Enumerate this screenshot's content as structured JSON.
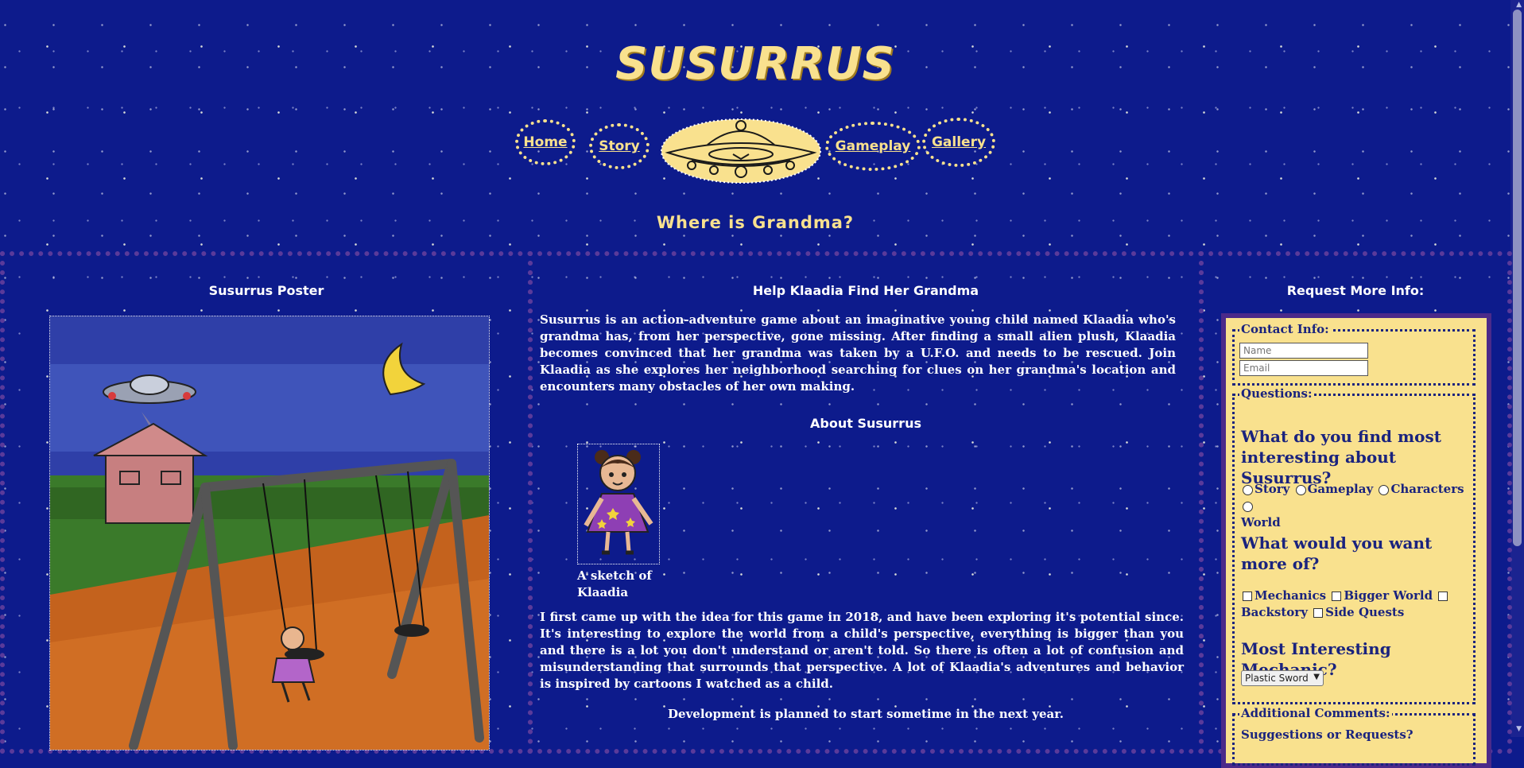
{
  "site": {
    "title": "SUSURRUS",
    "subtitle": "Where is Grandma?"
  },
  "nav": {
    "home": "Home",
    "story": "Story",
    "gameplay": "Gameplay",
    "gallery": "Gallery"
  },
  "left": {
    "heading": "Susurrus Poster"
  },
  "middle": {
    "heading": "Help Klaadia Find Her Grandma",
    "intro": "Susurrus is an action-adventure game about an imaginative young child named Klaadia who's grandma has, from her perspective, gone missing. After finding a small alien plush, Klaadia becomes convinced that her grandma was taken by a U.F.O. and needs to be rescued. Join Klaadia as she explores her neighborhood searching for clues on her grandma's location and encounters many obstacles of her own making.",
    "about_heading": "About Susurrus",
    "sketch_caption": "A sketch of Klaadia",
    "body": "I first came up with the idea for this game in 2018, and have been exploring it's potential since. It's interesting to explore the world from a child's perspective, everything is bigger than you and there is a lot you don't understand or aren't told. So there is often a lot of confusion and misunderstanding that surrounds that perspective. A lot of Klaadia's adventures and behavior is inspired by cartoons I watched as a child.",
    "development": "Development is planned to start sometime in the next year."
  },
  "form": {
    "heading": "Request More Info:",
    "contact_legend": "Contact Info:",
    "name_placeholder": "Name",
    "email_placeholder": "Email",
    "questions_legend": "Questions:",
    "q1": "What do you find most interesting about Susurrus?",
    "q1_options": [
      "Story",
      "Gameplay",
      "Characters",
      "World"
    ],
    "q2": "What would you want more of?",
    "q2_options": [
      "Mechanics",
      "Bigger World",
      "Backstory",
      "Side Quests"
    ],
    "q3": "Most Interesting Mechanic?",
    "q3_selected": "Plastic Sword",
    "comments_legend": "Additional Comments:",
    "comments_label": "Suggestions or Requests?"
  },
  "colors": {
    "background": "#0d1b8c",
    "accent": "#f9e18e",
    "panel_border": "#5a3a9a",
    "form_text": "#1a237e"
  }
}
